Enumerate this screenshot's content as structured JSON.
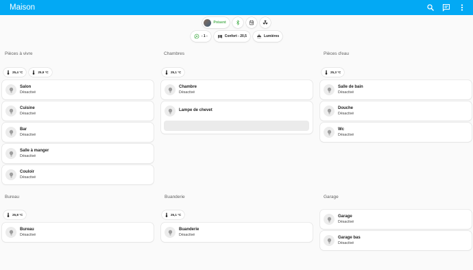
{
  "header": {
    "title": "Maison",
    "accent": "#03a9f4",
    "actions": [
      "search-icon",
      "assist-icon",
      "more-vert-icon"
    ]
  },
  "chips_row1": [
    {
      "id": "presence",
      "label": "Présent",
      "icon": "person-avatar"
    },
    {
      "id": "bluetooth",
      "label": "",
      "icon": "bluetooth-icon"
    },
    {
      "id": "calendar",
      "label": "",
      "icon": "calendar-icon"
    },
    {
      "id": "radiation",
      "label": "",
      "icon": "radioactive-icon"
    }
  ],
  "chips_row2": [
    {
      "id": "whatsapp",
      "label": "- 1 -",
      "icon": "whatsapp-icon"
    },
    {
      "id": "heating",
      "label": "Confort - 20,5",
      "icon": "radiator-icon"
    },
    {
      "id": "lights",
      "label": "Lumières",
      "icon": "ceiling-light-icon"
    }
  ],
  "sections": [
    {
      "title": "Pièces à vivre",
      "temps": [
        "25,4 °C",
        "25,9 °C"
      ],
      "cards": [
        {
          "name": "Salon",
          "state": "Désactivé"
        },
        {
          "name": "Cuisine",
          "state": "Désactivé"
        },
        {
          "name": "Bar",
          "state": "Désactivé"
        },
        {
          "name": "Salle à manger",
          "state": "Désactivé"
        },
        {
          "name": "Couloir",
          "state": "Désactivé"
        }
      ]
    },
    {
      "title": "Chambres",
      "temps": [
        "25,1 °C"
      ],
      "cards": [
        {
          "name": "Chambre",
          "state": "Désactivé"
        },
        {
          "name": "Lampe de chevet",
          "state": ""
        }
      ]
    },
    {
      "title": "Pièces d'eau",
      "temps": [
        "25,3 °C"
      ],
      "cards": [
        {
          "name": "Salle de bain",
          "state": "Désactivé"
        },
        {
          "name": "Douche",
          "state": "Désactivé"
        },
        {
          "name": "Wc",
          "state": "Désactivé"
        }
      ]
    },
    {
      "title": "Bureau",
      "temps": [
        "25,8 °C"
      ],
      "cards": [
        {
          "name": "Bureau",
          "state": "Désactivé"
        }
      ]
    },
    {
      "title": "Buanderie",
      "temps": [
        "25,1 °C"
      ],
      "cards": [
        {
          "name": "Buanderie",
          "state": "Désactivé"
        }
      ]
    },
    {
      "title": "Garage",
      "temps": [],
      "cards": [
        {
          "name": "Garage",
          "state": "Désactivé"
        },
        {
          "name": "Garage bas",
          "state": "Désactivé"
        }
      ]
    }
  ]
}
